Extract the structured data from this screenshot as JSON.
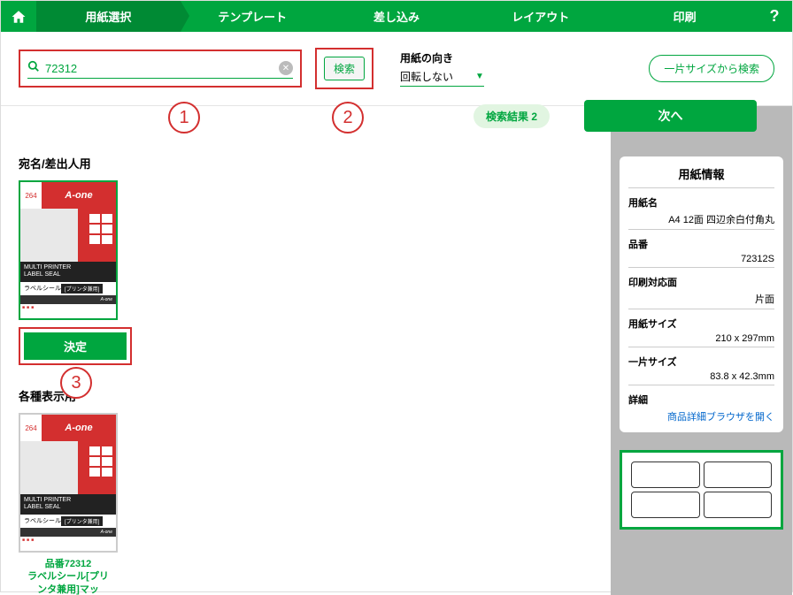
{
  "nav": {
    "steps": [
      "用紙選択",
      "テンプレート",
      "差し込み",
      "レイアウト",
      "印刷"
    ],
    "active_index": 0
  },
  "search": {
    "value": "72312",
    "button_label": "検索",
    "orientation_label": "用紙の向き",
    "orientation_value": "回転しない",
    "size_search_label": "一片サイズから検索"
  },
  "results": {
    "badge": "検索結果 2",
    "next_label": "次へ"
  },
  "annotations": [
    "1",
    "2",
    "3"
  ],
  "categories": {
    "addressee": "宛名/差出人用",
    "display": "各種表示用"
  },
  "card": {
    "face_count": "264",
    "brand": "A-one",
    "multi_line1": "MULTI PRINTER",
    "multi_line2": "LABEL SEAL",
    "label_text": "ラベルシール",
    "label_tag": "[プリンタ兼用]",
    "decide_label": "決定",
    "caption_line1": "品番72312",
    "caption_line2": "ラベルシール[プリ",
    "caption_line3": "ンタ兼用]マッ"
  },
  "info": {
    "title": "用紙情報",
    "rows": [
      {
        "label": "用紙名",
        "value": "A4 12面 四辺余白付角丸"
      },
      {
        "label": "品番",
        "value": "72312S"
      },
      {
        "label": "印刷対応面",
        "value": "片面"
      },
      {
        "label": "用紙サイズ",
        "value": "210 x 297mm"
      },
      {
        "label": "一片サイズ",
        "value": "83.8 x 42.3mm"
      }
    ],
    "detail_label": "詳細",
    "detail_link": "商品詳細ブラウザを開く"
  }
}
